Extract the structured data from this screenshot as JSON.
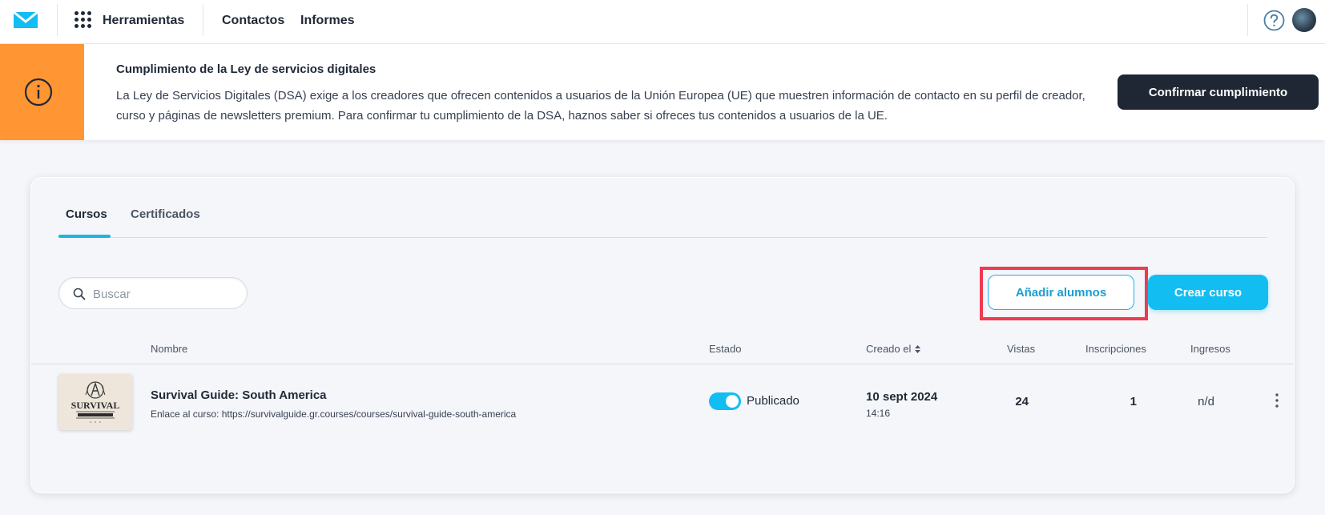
{
  "topbar": {
    "logo": "envelope-logo",
    "tools_label": "Herramientas",
    "nav": [
      "Contactos",
      "Informes"
    ],
    "help_icon": "question-circle-icon",
    "avatar": "user-avatar"
  },
  "banner": {
    "icon": "info-circle-icon",
    "accent_color": "#ff9533",
    "title": "Cumplimiento de la Ley de servicios digitales",
    "text": "La Ley de Servicios Digitales (DSA) exige a los creadores que ofrecen contenidos a usuarios de la Unión Europea (UE) que muestren información de contacto en su perfil de creador, curso y páginas de newsletters premium. Para confirmar tu cumplimiento de la DSA, haznos saber si ofreces tus contenidos a usuarios de la UE.",
    "button": "Confirmar cumplimiento"
  },
  "tabs": [
    "Cursos",
    "Certificados"
  ],
  "active_tab": "Cursos",
  "search": {
    "placeholder": "Buscar",
    "value": ""
  },
  "actions": {
    "add_students": "Añadir alumnos",
    "create_course": "Crear curso"
  },
  "table": {
    "columns": [
      "Nombre",
      "Estado",
      "Creado el",
      "Vistas",
      "Inscripciones",
      "Ingresos"
    ],
    "rows": [
      {
        "thumbnail_text": "SURVIVAL",
        "name": "Survival Guide: South America",
        "link": "Enlace al curso: https://survivalguide.gr.courses/courses/survival-guide-south-america",
        "published": true,
        "status": "Publicado",
        "date": "10 sept 2024",
        "time": "14:16",
        "views": "24",
        "enrollments": "1",
        "income": "n/d"
      }
    ]
  },
  "colors": {
    "primary": "#12bdf2",
    "dark_button": "#1f2734",
    "highlight": "#ef3a4f"
  }
}
